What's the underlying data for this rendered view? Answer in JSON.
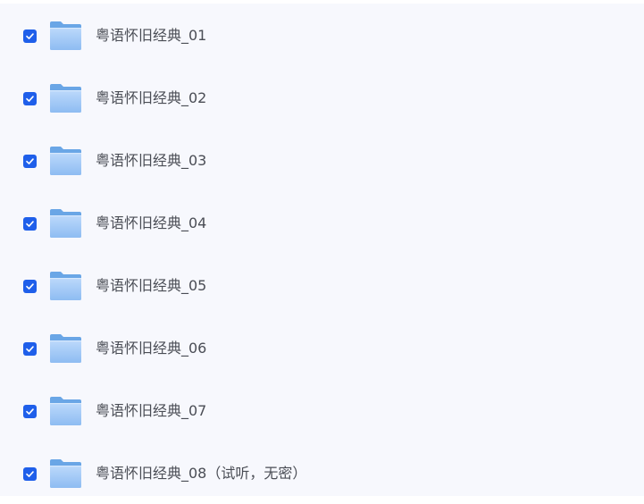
{
  "file_list": {
    "items": [
      {
        "name": "粤语怀旧经典_01",
        "checked": true
      },
      {
        "name": "粤语怀旧经典_02",
        "checked": true
      },
      {
        "name": "粤语怀旧经典_03",
        "checked": true
      },
      {
        "name": "粤语怀旧经典_04",
        "checked": true
      },
      {
        "name": "粤语怀旧经典_05",
        "checked": true
      },
      {
        "name": "粤语怀旧经典_06",
        "checked": true
      },
      {
        "name": "粤语怀旧经典_07",
        "checked": true
      },
      {
        "name": "粤语怀旧经典_08（试听，无密）",
        "checked": true
      }
    ]
  },
  "icons": {
    "checkbox": "checkmark-icon",
    "folder": "folder-icon"
  },
  "colors": {
    "background": "#f7f8fd",
    "checkbox": "#1f5fea",
    "folder_back": "#6aa6e6",
    "folder_front_top": "#b9d7fb",
    "folder_front_bottom": "#8fbdf3",
    "text": "#4a4d55"
  }
}
